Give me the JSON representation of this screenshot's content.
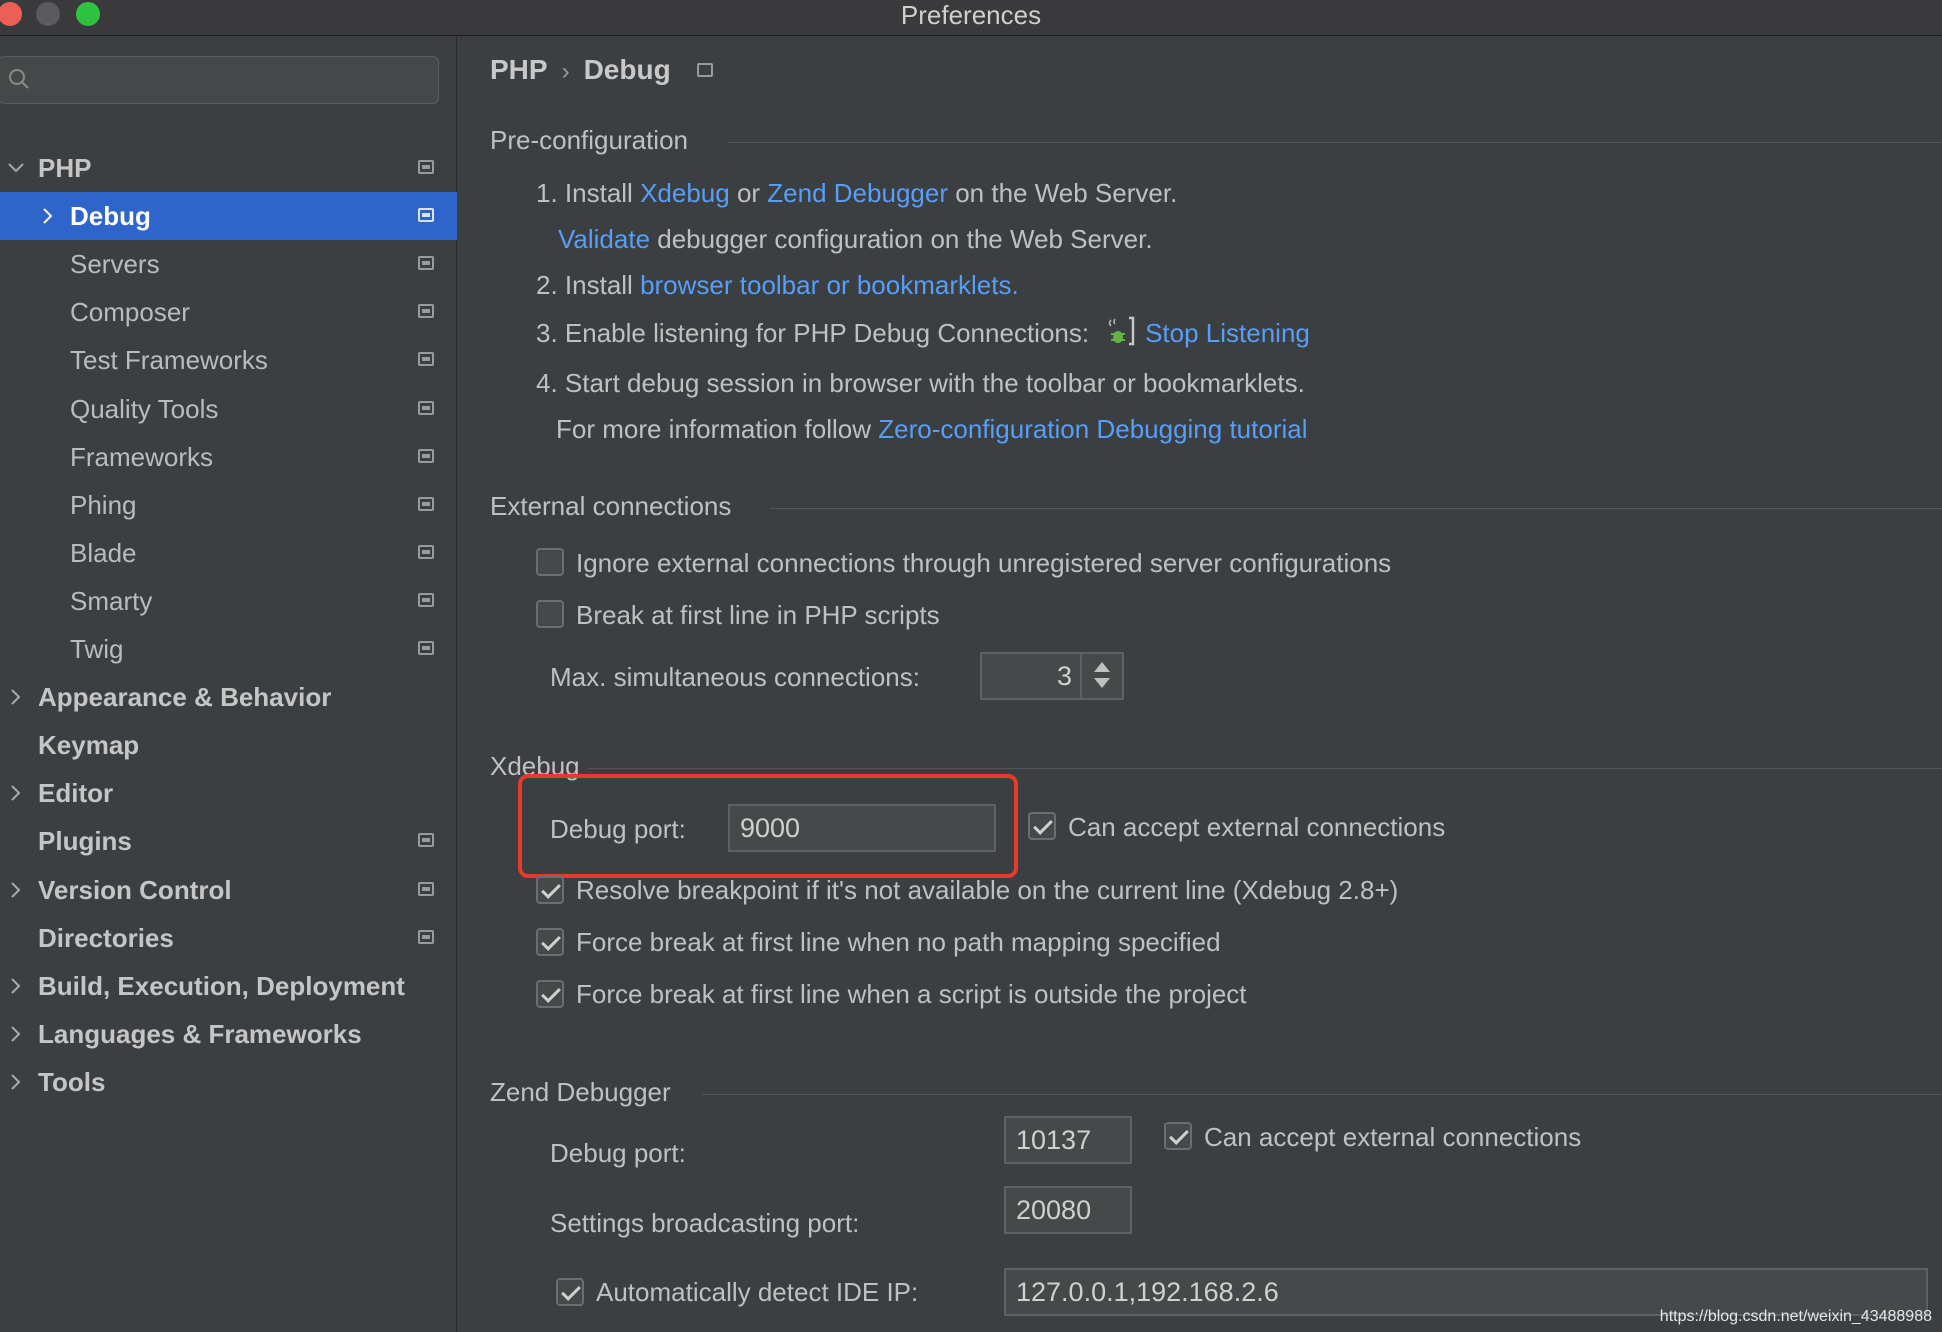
{
  "window": {
    "title": "Preferences"
  },
  "sidebar": {
    "search_placeholder": "",
    "items": [
      {
        "label": "PHP",
        "level": 0,
        "bold": true,
        "expander": "expanded",
        "project_icon": true,
        "selected": false
      },
      {
        "label": "Debug",
        "level": 1,
        "bold": false,
        "expander": "collapsed",
        "project_icon": true,
        "selected": true
      },
      {
        "label": "Servers",
        "level": 1,
        "bold": false,
        "expander": "none",
        "project_icon": true,
        "selected": false
      },
      {
        "label": "Composer",
        "level": 1,
        "bold": false,
        "expander": "none",
        "project_icon": true,
        "selected": false
      },
      {
        "label": "Test Frameworks",
        "level": 1,
        "bold": false,
        "expander": "none",
        "project_icon": true,
        "selected": false
      },
      {
        "label": "Quality Tools",
        "level": 1,
        "bold": false,
        "expander": "none",
        "project_icon": true,
        "selected": false
      },
      {
        "label": "Frameworks",
        "level": 1,
        "bold": false,
        "expander": "none",
        "project_icon": true,
        "selected": false
      },
      {
        "label": "Phing",
        "level": 1,
        "bold": false,
        "expander": "none",
        "project_icon": true,
        "selected": false
      },
      {
        "label": "Blade",
        "level": 1,
        "bold": false,
        "expander": "none",
        "project_icon": true,
        "selected": false
      },
      {
        "label": "Smarty",
        "level": 1,
        "bold": false,
        "expander": "none",
        "project_icon": true,
        "selected": false
      },
      {
        "label": "Twig",
        "level": 1,
        "bold": false,
        "expander": "none",
        "project_icon": true,
        "selected": false
      },
      {
        "label": "Appearance & Behavior",
        "level": 0,
        "bold": true,
        "expander": "collapsed",
        "project_icon": false,
        "selected": false
      },
      {
        "label": "Keymap",
        "level": 0,
        "bold": true,
        "expander": "none",
        "project_icon": false,
        "selected": false
      },
      {
        "label": "Editor",
        "level": 0,
        "bold": true,
        "expander": "collapsed",
        "project_icon": false,
        "selected": false
      },
      {
        "label": "Plugins",
        "level": 0,
        "bold": true,
        "expander": "none",
        "project_icon": true,
        "selected": false
      },
      {
        "label": "Version Control",
        "level": 0,
        "bold": true,
        "expander": "collapsed",
        "project_icon": true,
        "selected": false
      },
      {
        "label": "Directories",
        "level": 0,
        "bold": true,
        "expander": "none",
        "project_icon": true,
        "selected": false
      },
      {
        "label": "Build, Execution, Deployment",
        "level": 0,
        "bold": true,
        "expander": "collapsed",
        "project_icon": false,
        "selected": false
      },
      {
        "label": "Languages & Frameworks",
        "level": 0,
        "bold": true,
        "expander": "collapsed",
        "project_icon": false,
        "selected": false
      },
      {
        "label": "Tools",
        "level": 0,
        "bold": true,
        "expander": "collapsed",
        "project_icon": false,
        "selected": false
      }
    ]
  },
  "breadcrumb": {
    "parent": "PHP",
    "separator": "›",
    "current": "Debug"
  },
  "preconfig": {
    "title": "Pre-configuration",
    "step1_prefix": "1. Install ",
    "step1_link1": "Xdebug",
    "step1_or": " or ",
    "step1_link2": "Zend Debugger",
    "step1_suffix": " on the Web Server.",
    "validate_link": "Validate",
    "validate_suffix": " debugger configuration on the Web Server.",
    "step2_prefix": "2. Install ",
    "step2_link": "browser toolbar or bookmarklets.",
    "step3_prefix": "3. Enable listening for PHP Debug Connections:",
    "step3_link": "Stop Listening",
    "step4": "4. Start debug session in browser with the toolbar or bookmarklets.",
    "info_prefix": "For more information follow ",
    "info_link": "Zero-configuration Debugging tutorial"
  },
  "external": {
    "title": "External connections",
    "ignore_label": "Ignore external connections through unregistered server configurations",
    "ignore_checked": false,
    "break_label": "Break at first line in PHP scripts",
    "break_checked": false,
    "max_label": "Max. simultaneous connections:",
    "max_value": "3"
  },
  "xdebug": {
    "title": "Xdebug",
    "port_label": "Debug port:",
    "port_value": "9000",
    "accept_label": "Can accept external connections",
    "accept_checked": true,
    "resolve_label": "Resolve breakpoint if it's not available on the current line (Xdebug 2.8+)",
    "resolve_checked": true,
    "force_nopath_label": "Force break at first line when no path mapping specified",
    "force_nopath_checked": true,
    "force_outside_label": "Force break at first line when a script is outside the project",
    "force_outside_checked": true,
    "highlight_color": "#e53a2e"
  },
  "zend": {
    "title": "Zend Debugger",
    "port_label": "Debug port:",
    "port_value": "10137",
    "accept_label": "Can accept external connections",
    "accept_checked": true,
    "broadcast_label": "Settings broadcasting port:",
    "broadcast_value": "20080",
    "detect_label": "Automatically detect IDE IP:",
    "detect_checked": true,
    "ip_value": "127.0.0.1,192.168.2.6"
  },
  "watermark": "https://blog.csdn.net/weixin_43488988",
  "colors": {
    "background": "#3c3f41",
    "selection": "#2f65ca",
    "link": "#589df6",
    "text": "#bbbbbb"
  }
}
